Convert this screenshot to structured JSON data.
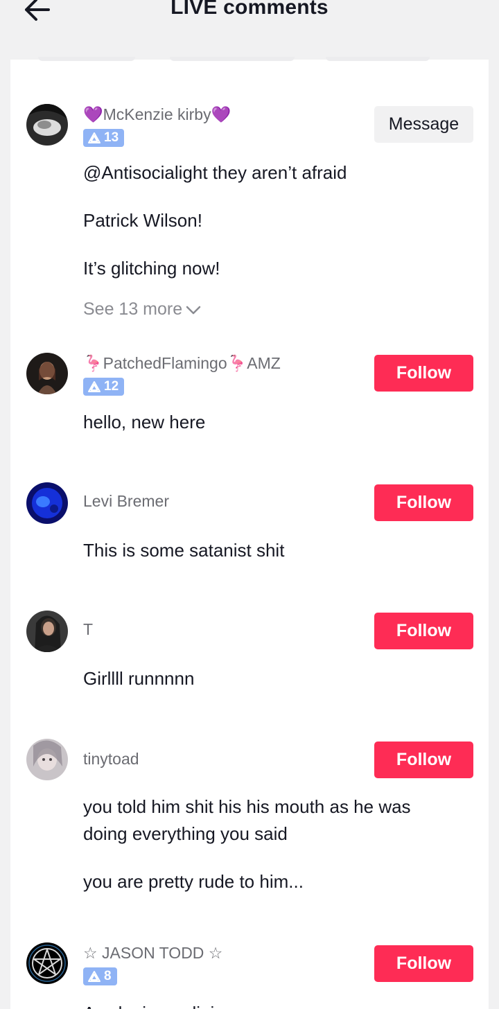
{
  "header": {
    "title": "LIVE comments",
    "back_icon": "arrow-left-icon"
  },
  "colors": {
    "follow": "#fe2c55",
    "badge": "#8fb3f5",
    "username": "#6b6c72",
    "see_more": "#8a8b91"
  },
  "comments": [
    {
      "username": "💜McKenzie kirby💜",
      "badge": "13",
      "action": "Message",
      "lines": [
        "@Antisocialight they aren’t afraid",
        "Patrick Wilson!",
        "It’s glitching now!"
      ],
      "see_more": "See 13 more"
    },
    {
      "username": "🦩PatchedFlamingo🦩AMZ",
      "badge": "12",
      "action": "Follow",
      "lines": [
        "hello, new here"
      ]
    },
    {
      "username": "Levi Bremer",
      "action": "Follow",
      "lines": [
        "This is some satanist shit"
      ]
    },
    {
      "username": "T",
      "action": "Follow",
      "lines": [
        "Girllll runnnnn"
      ]
    },
    {
      "username": "tinytoad",
      "action": "Follow",
      "lines": [
        "you told him shit his his mouth as he was",
        "doing everything you said",
        "you are pretty rude to him..."
      ]
    },
    {
      "username": "☆ JASON TODD ☆",
      "badge": "8",
      "action": "Follow",
      "lines": [
        "A colonizer religion"
      ]
    }
  ]
}
